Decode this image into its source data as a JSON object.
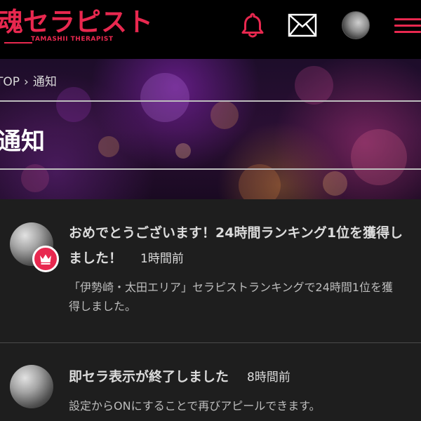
{
  "header": {
    "logo_text": "魂セラピスト",
    "logo_subtext": "TAMASHII THERAPIST",
    "icons": [
      "bell-icon",
      "mail-icon",
      "user-avatar",
      "hamburger-menu-icon"
    ],
    "accent_color": "#e8284f"
  },
  "breadcrumb": {
    "items": [
      "TOP",
      "通知"
    ]
  },
  "page": {
    "title": "通知"
  },
  "notifications": [
    {
      "title": "おめでとうございます！24時間ランキング1位を獲得しました！",
      "time": "1時間前",
      "body": "「伊勢崎・太田エリア」セラピストランキングで24時間1位を獲得しました。",
      "badge": "crown-icon"
    },
    {
      "title": "即セラ表示が終了しました",
      "time": "8時間前",
      "body": "設定からONにすることで再びアピールできます。"
    }
  ]
}
